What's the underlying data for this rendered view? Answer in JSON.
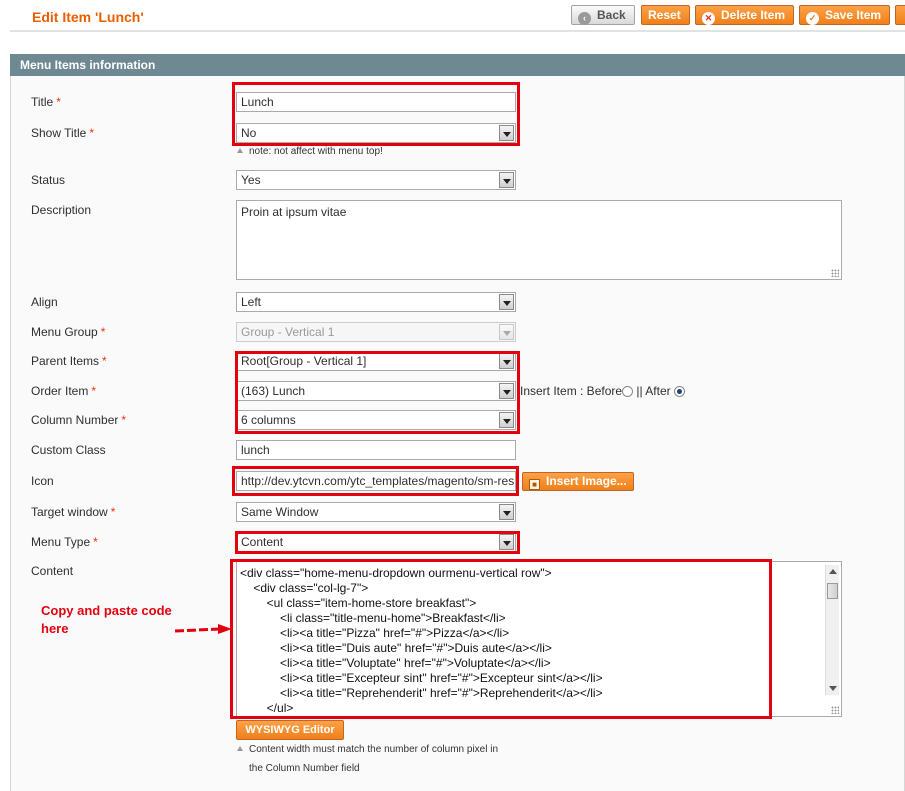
{
  "header": {
    "title": "Edit Item 'Lunch'",
    "buttons": {
      "back": "Back",
      "reset": "Reset",
      "delete": "Delete Item",
      "save": "Save Item"
    }
  },
  "section": {
    "title": "Menu Items information"
  },
  "form": {
    "title": {
      "label": "Title",
      "value": "Lunch"
    },
    "show_title": {
      "label": "Show Title",
      "value": "No",
      "note": "note: not affect with menu top!"
    },
    "status": {
      "label": "Status",
      "value": "Yes"
    },
    "description": {
      "label": "Description",
      "value": "Proin at ipsum vitae"
    },
    "align": {
      "label": "Align",
      "value": "Left"
    },
    "menu_group": {
      "label": "Menu Group",
      "value": "Group - Vertical 1"
    },
    "parent_items": {
      "label": "Parent Items",
      "value": "Root[Group - Vertical 1]"
    },
    "order_item": {
      "label": "Order Item",
      "value": "(163) Lunch",
      "insert_label": "Insert Item : Before",
      "separator": "||",
      "after_label": "After"
    },
    "column_number": {
      "label": "Column Number",
      "value": "6 columns"
    },
    "custom_class": {
      "label": "Custom Class",
      "value": "lunch"
    },
    "icon": {
      "label": "Icon",
      "value": "http://dev.ytcvn.com/ytc_templates/magento/sm-res",
      "insert_button": "Insert Image..."
    },
    "target_window": {
      "label": "Target window",
      "value": "Same Window"
    },
    "menu_type": {
      "label": "Menu Type",
      "value": "Content"
    },
    "content": {
      "label": "Content",
      "lines": [
        "<div class=\"home-menu-dropdown ourmenu-vertical row\">",
        "    <div class=\"col-lg-7\">",
        "        <ul class=\"item-home-store breakfast\">",
        "            <li class=\"title-menu-home\">Breakfast</li>",
        "            <li><a title=\"Pizza\" href=\"#\">Pizza</a></li>",
        "            <li><a title=\"Duis aute\" href=\"#\">Duis aute</a></li>",
        "            <li><a title=\"Voluptate\" href=\"#\">Voluptate</a></li>",
        "            <li><a title=\"Excepteur sint\" href=\"#\">Excepteur sint</a></li>",
        "            <li><a title=\"Reprehenderit\" href=\"#\">Reprehenderit</a></li>",
        "        </ul>"
      ],
      "wysiwyg_button": "WYSIWYG Editor",
      "note_line1": "Content width must match the number of column pixel in",
      "note_line2": "the Column Number field"
    }
  },
  "annotation": {
    "line1": "Copy and paste code",
    "line2": "here"
  },
  "colors": {
    "accent": "#eb5e00",
    "highlight": "#e3000f",
    "section": "#6f8992"
  }
}
